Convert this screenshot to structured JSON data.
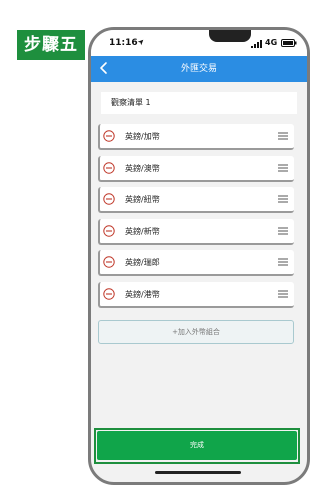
{
  "step_label": "步驟五",
  "status_bar": {
    "time": "11:16",
    "network": "4G"
  },
  "nav": {
    "title": "外匯交易"
  },
  "watchlist": {
    "name": "觀察清單 1"
  },
  "currency_pairs": [
    {
      "label": "英鎊/加幣"
    },
    {
      "label": "英鎊/澳幣"
    },
    {
      "label": "英鎊/紐幣"
    },
    {
      "label": "英鎊/新幣"
    },
    {
      "label": "英鎊/瑞郎"
    },
    {
      "label": "英鎊/港幣"
    }
  ],
  "add_combo_label": "+加入外幣組合",
  "done_label": "完成",
  "icons": {
    "back": "chevron-left-icon",
    "remove": "minus-circle-icon",
    "drag": "drag-handle-icon",
    "location": "location-arrow-icon",
    "signal": "signal-icon",
    "battery": "battery-icon"
  },
  "colors": {
    "nav_bg": "#2b8de3",
    "step_badge": "#1e8f3e",
    "done_button": "#10a54a",
    "remove_icon": "#c0392b"
  }
}
